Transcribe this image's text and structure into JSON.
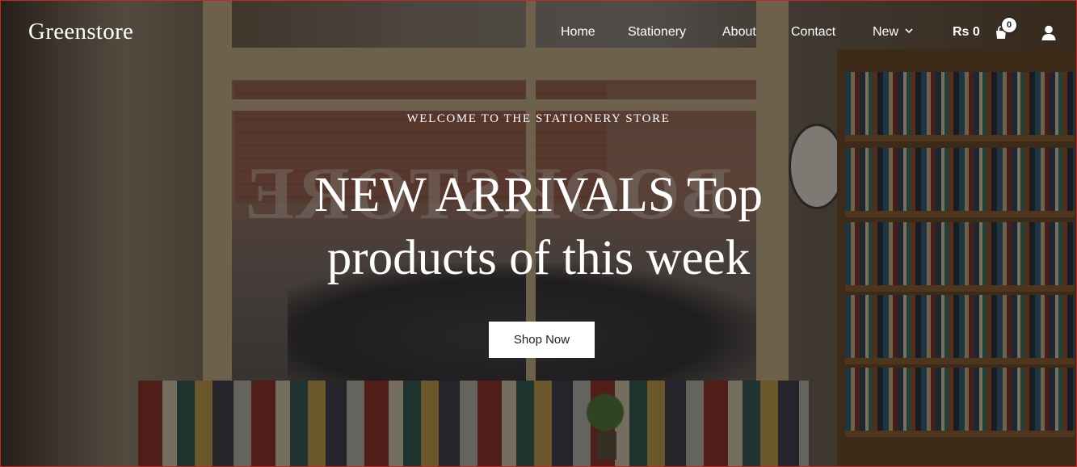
{
  "header": {
    "logo": "Greenstore",
    "nav": [
      {
        "label": "Home"
      },
      {
        "label": "Stationery"
      },
      {
        "label": "About"
      },
      {
        "label": "Contact"
      },
      {
        "label": "New"
      }
    ],
    "currency": "Rs 0",
    "cart_count": "0",
    "icons": {
      "nav_dropdown": "chevron-down-icon",
      "cart": "cart-icon",
      "account": "user-icon"
    }
  },
  "hero": {
    "kicker": "WELCOME TO THE STATIONERY STORE",
    "headline": "NEW ARRIVALS Top products of this week",
    "cta_label": "Shop Now",
    "background_sign_text": "BOOKSTORE"
  },
  "colors": {
    "text": "#ffffff",
    "button_bg": "#ffffff",
    "button_text": "#1e1e1e",
    "overlay": "rgba(18,14,10,0.5)",
    "frame_border": "#c62828"
  }
}
